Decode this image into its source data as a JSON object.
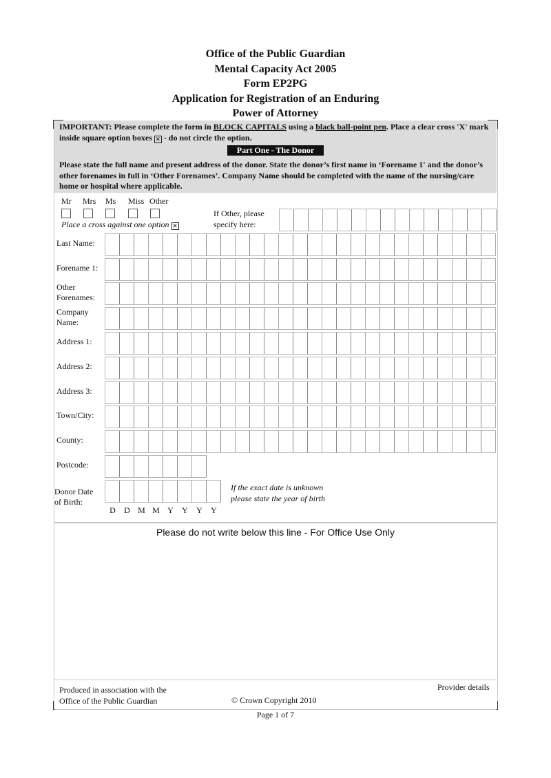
{
  "header": {
    "line1": "Office of the Public Guardian",
    "line2": "Mental Capacity Act 2005",
    "line3": "Form EP2PG",
    "line4": "Application for Registration of an Enduring",
    "line5": "Power of Attorney"
  },
  "notice": {
    "important_prefix": "IMPORTANT: Please complete the form in ",
    "block_capitals": "BLOCK CAPITALS",
    "using_a": " using a ",
    "pen": "black ball-point pen",
    "cross_instruction": ".  Place a clear cross 'X' mark inside square option boxes ",
    "cross_glyph": "☒",
    "no_circle": " - do not circle the option.",
    "part_title": "Part One - The Donor",
    "description": "Please state the full name and present address of the donor.  State the donor’s first name in ‘Forename 1' and the donor’s other forenames in full in ‘Other Forenames’. Company Name should be completed with the name of the nursing/care home or hospital where applicable."
  },
  "titles": {
    "options": [
      "Mr",
      "Mrs",
      "Ms",
      "Miss",
      "Other"
    ],
    "hint": "Place a cross against one option ",
    "hint_glyph": "☒",
    "other_label_line1": "If Other, please",
    "other_label_line2": "specify here:"
  },
  "fields": {
    "last_name": "Last Name:",
    "forename1": "Forename 1:",
    "other_forenames_1": "Other",
    "other_forenames_2": "Forenames:",
    "company_1": "Company",
    "company_2": "Name:",
    "address1": "Address 1:",
    "address2": "Address 2:",
    "address3": "Address 3:",
    "town": "Town/City:",
    "county": "County:",
    "postcode": "Postcode:",
    "dob_1": "Donor Date",
    "dob_2": "of Birth:"
  },
  "dob": {
    "letters": [
      "D",
      "D",
      "M",
      "M",
      "Y",
      "Y",
      "Y",
      "Y"
    ],
    "note_line1": "If the exact date is unknown",
    "note_line2": "please state the year of birth"
  },
  "office_use": "Please do not write below this line - For Office Use Only",
  "footer": {
    "produced_line1": "Produced in association with the",
    "produced_line2": "Office of the Public Guardian",
    "copyright": "© Crown Copyright 2010",
    "provider": "Provider details",
    "page": "Page 1 of  7"
  }
}
